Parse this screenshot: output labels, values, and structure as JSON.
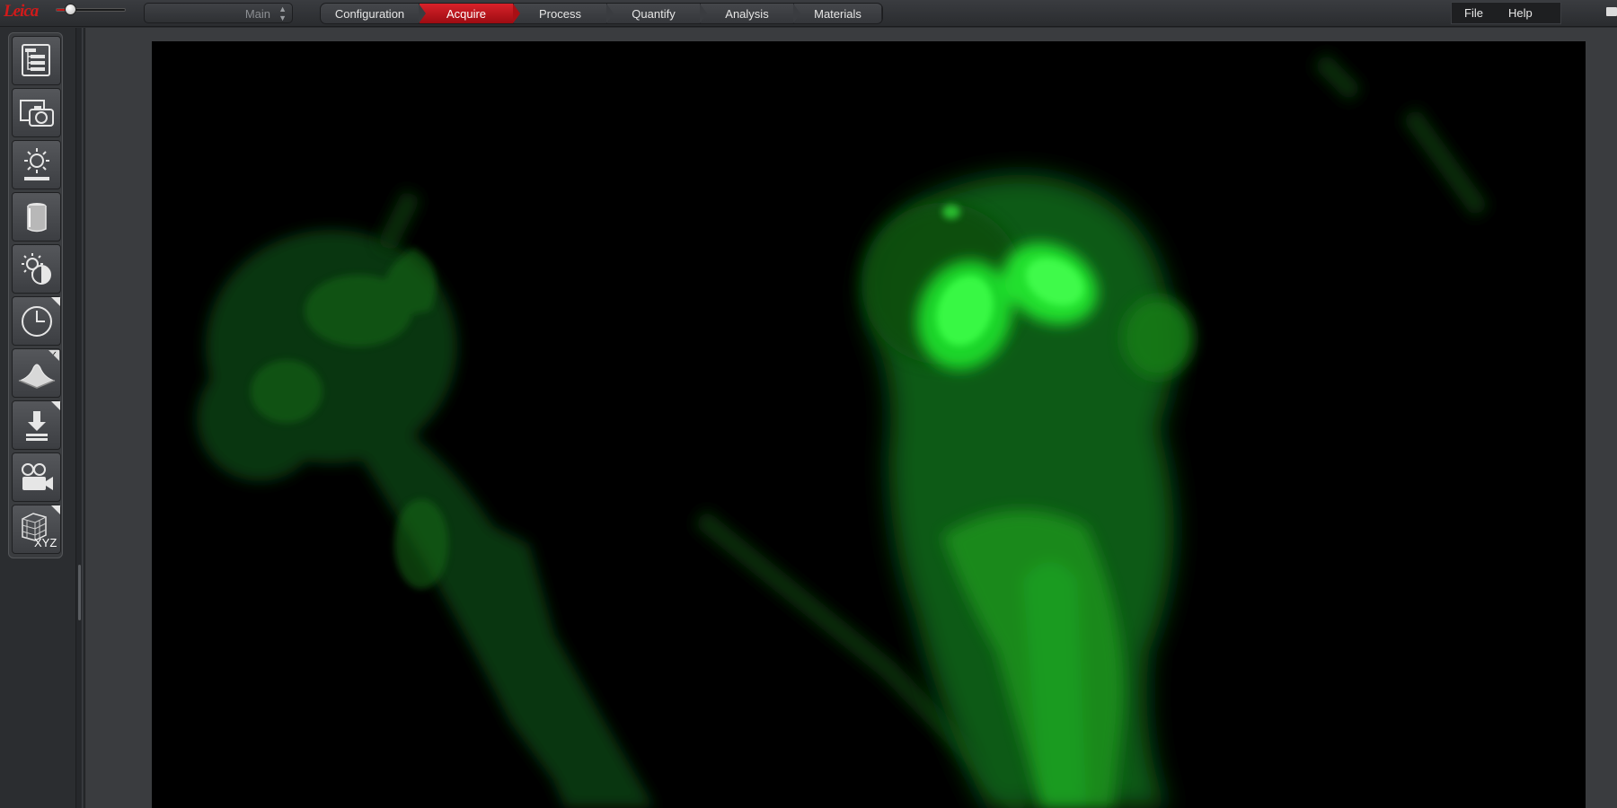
{
  "app": {
    "logo_text": "Leica",
    "selector_value": "Main",
    "accent_color": "#c8141b"
  },
  "zoom_slider": {
    "value_fraction": 0.2
  },
  "workflow_tabs": [
    {
      "label": "Configuration",
      "active": false
    },
    {
      "label": "Acquire",
      "active": true
    },
    {
      "label": "Process",
      "active": false
    },
    {
      "label": "Quantify",
      "active": false
    },
    {
      "label": "Analysis",
      "active": false
    },
    {
      "label": "Materials",
      "active": false
    }
  ],
  "menu": {
    "file": "File",
    "help": "Help"
  },
  "tools": [
    {
      "icon": "experiment-tree-icon",
      "flag": "none"
    },
    {
      "icon": "camera-icon",
      "flag": "none"
    },
    {
      "icon": "illumination-icon",
      "flag": "none"
    },
    {
      "icon": "objective-icon",
      "flag": "none"
    },
    {
      "icon": "fluorescence-icon",
      "flag": "none"
    },
    {
      "icon": "timelapse-clock-icon",
      "flag": "corner"
    },
    {
      "icon": "z-stack-surface-icon",
      "flag": "check"
    },
    {
      "icon": "save-download-icon",
      "flag": "corner"
    },
    {
      "icon": "movie-camera-icon",
      "flag": "none"
    },
    {
      "icon": "xyz-cube-icon",
      "flag": "corner",
      "label": "XYZ"
    }
  ],
  "image": {
    "channel_color": "#00ff3c",
    "description_icon": "fluorescence-image"
  }
}
